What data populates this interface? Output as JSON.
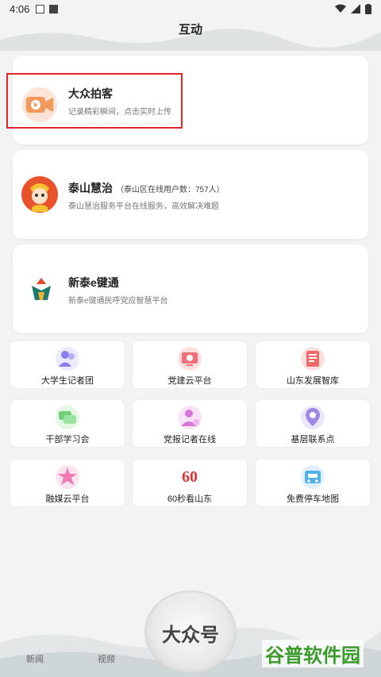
{
  "status_bar": {
    "time": "4:06"
  },
  "header": {
    "title": "互动"
  },
  "cards": [
    {
      "title": "大众拍客",
      "subtitle": "",
      "desc": "记录精彩瞬间，点击实时上传"
    },
    {
      "title": "泰山慧治",
      "subtitle": "（泰山区在线用户数：757人）",
      "desc": "泰山慧治服务平台在线服务，高效解决难题"
    },
    {
      "title": "新泰e键通",
      "subtitle": "",
      "desc": "新泰e键通民呼党应智慧平台"
    }
  ],
  "grid": [
    {
      "label": "大学生记者团",
      "icon": "students-icon"
    },
    {
      "label": "党建云平台",
      "icon": "party-cloud-icon"
    },
    {
      "label": "山东发展智库",
      "icon": "news-icon"
    },
    {
      "label": "干部学习会",
      "icon": "chat-bubbles-icon"
    },
    {
      "label": "党报记者在线",
      "icon": "reporter-icon"
    },
    {
      "label": "基层联系点",
      "icon": "location-pin-icon"
    },
    {
      "label": "融媒云平台",
      "icon": "star-icon"
    },
    {
      "label": "60秒看山东",
      "icon": "sixty-icon"
    },
    {
      "label": "免费停车地图",
      "icon": "car-map-icon"
    }
  ],
  "sixty_logo_text": "60",
  "bottom_nav": {
    "news": "新闻",
    "video": "视频",
    "center": "大众号"
  },
  "watermark": "谷普软件园",
  "colors": {
    "highlight": "#e0242a",
    "accent_orange": "#f39a5b"
  }
}
